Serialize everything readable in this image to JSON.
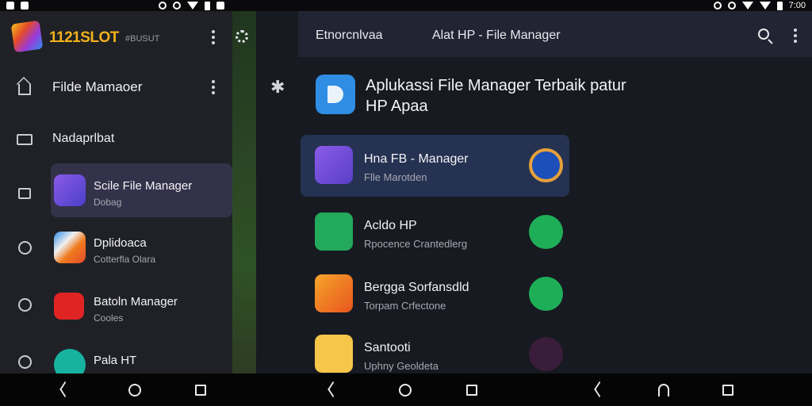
{
  "status_bar": {
    "time": "7:00"
  },
  "drawer": {
    "brand": "1121SLOT",
    "brand_sub": "#BUSUT",
    "title": "Filde Mamaoer",
    "label": "Nadaprlbat",
    "apps": [
      {
        "name": "Scile File Manager",
        "sub": "Dobag",
        "icon": "file-manager-app-icon",
        "color": "#5a4fd8"
      },
      {
        "name": "Dplidoaca",
        "sub": "Cotterfla Olara",
        "icon": "play-store-icon",
        "color": "#f1f1f1"
      },
      {
        "name": "Batoln Manager",
        "sub": "Cooles",
        "icon": "youtube-play-icon",
        "color": "#e02424"
      },
      {
        "name": "Pala HT",
        "sub": "",
        "icon": "teal-app-icon",
        "color": "#18b3a0"
      }
    ]
  },
  "main": {
    "topbar_left": "Etnorcnlvaa",
    "topbar_title": "Alat HP - File Manager",
    "header_title": "Aplukassi File Manager Terbaik patur HP Apaa",
    "cards": [
      {
        "name": "Hna FB - Manager",
        "sub": "Flle Marotden",
        "icon": "file-manager-app-icon",
        "icon_color": "#6a4fd8",
        "btn_color": "#1c4fb8",
        "btn_border": "#e5a13a",
        "selected": true
      },
      {
        "name": "Acldo HP",
        "sub": "Rpocence Crantedlerg",
        "icon": "hp-app-icon",
        "icon_color": "#22a95b",
        "btn_color": "#1fae58",
        "btn_border": "#1fae58",
        "selected": false
      },
      {
        "name": "Bergga Sorfansdld",
        "sub": "Torpam Crfectone",
        "icon": "edit-app-icon",
        "icon_color": "#f07a1e",
        "btn_color": "#1fae58",
        "btn_border": "#1fae58",
        "selected": false
      },
      {
        "name": "Santooti",
        "sub": "Uphny Geoldeta",
        "icon": "youtube-app-icon",
        "icon_color": "#f6c64a",
        "btn_color": "#3a1d3a",
        "btn_border": "#3a1d3a",
        "selected": false
      }
    ]
  }
}
